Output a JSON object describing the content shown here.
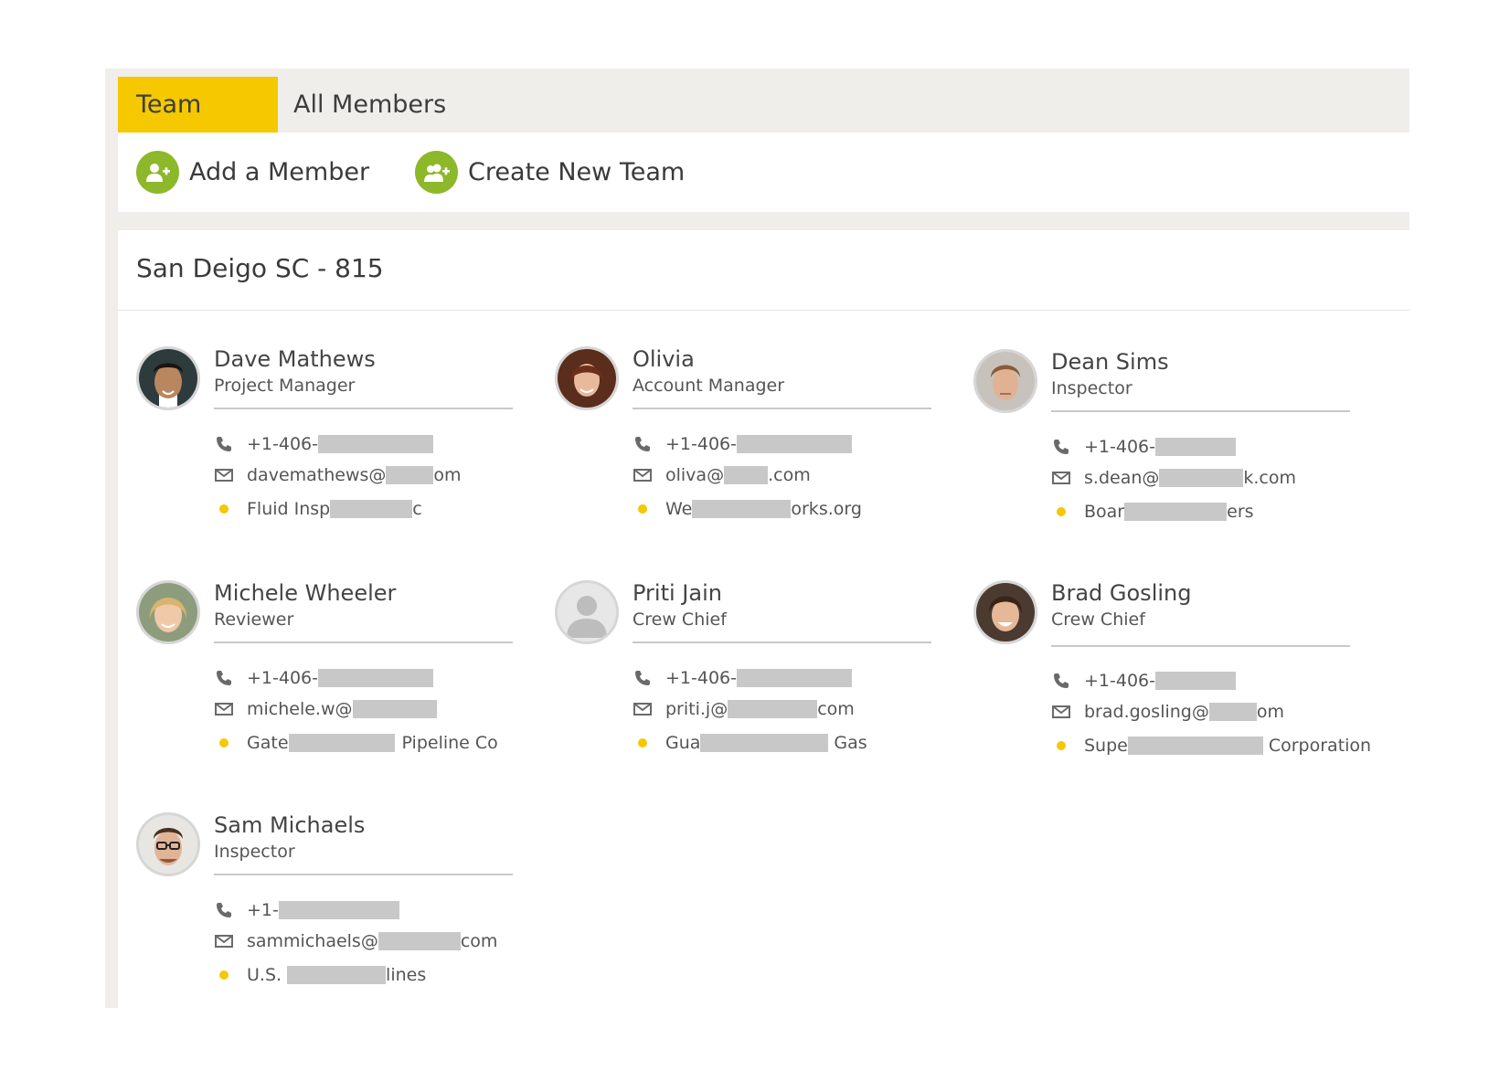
{
  "tabs": [
    {
      "label": "Team",
      "active": true
    },
    {
      "label": "All Members",
      "active": false
    }
  ],
  "actions": {
    "add_member": "Add a Member",
    "create_team": "Create New Team"
  },
  "team": {
    "title": "San Deigo SC - 815"
  },
  "colors": {
    "accent": "#f5c800",
    "action_green": "#8cb829",
    "panel_bg": "#efeeeb"
  },
  "members": [
    {
      "name": "Dave Mathews",
      "role": "Project Manager",
      "phone": "+1-406-",
      "email_pre": "davemathews@",
      "email_post": "om",
      "company_pre": "Fluid Insp",
      "company_post": "c"
    },
    {
      "name": "Olivia",
      "role": "Account Manager",
      "phone": "+1-406-",
      "email_pre": "oliva@",
      "email_post": ".com",
      "company_pre": "We",
      "company_post": "orks.org"
    },
    {
      "name": "Dean Sims",
      "role": "Inspector",
      "phone": "+1-406-",
      "email_pre": "s.dean@",
      "email_post": "k.com",
      "company_pre": "Boar",
      "company_post": "ers"
    },
    {
      "name": "Michele Wheeler",
      "role": "Reviewer",
      "phone": "+1-406-",
      "email_pre": "michele.w@",
      "email_post": "",
      "company_pre": "Gate",
      "company_post": "Pipeline Co"
    },
    {
      "name": "Priti Jain",
      "role": "Crew Chief",
      "phone": "+1-406-",
      "email_pre": "priti.j@",
      "email_post": "com",
      "company_pre": "Gua",
      "company_post": "Gas"
    },
    {
      "name": "Brad Gosling",
      "role": "Crew Chief",
      "phone": "+1-406-",
      "email_pre": "brad.gosling@",
      "email_post": "om",
      "company_pre": "Supe",
      "company_post": "Corporation"
    },
    {
      "name": "Sam Michaels",
      "role": "Inspector",
      "phone": "+1-",
      "email_pre": "sammichaels@",
      "email_post": "com",
      "company_pre": "U.S.",
      "company_post": "lines"
    }
  ]
}
